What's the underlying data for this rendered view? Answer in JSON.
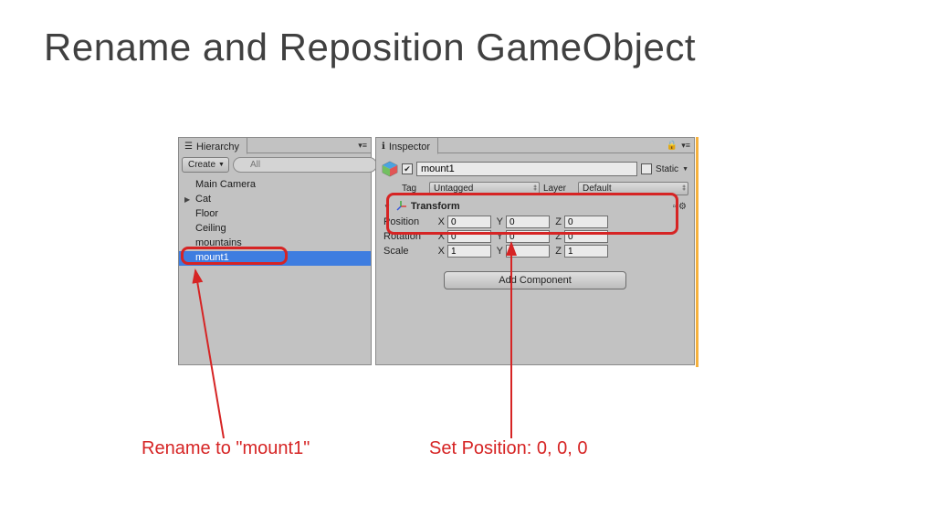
{
  "slide": {
    "title": "Rename and Reposition GameObject"
  },
  "hierarchy": {
    "tab_label": "Hierarchy",
    "create_label": "Create",
    "search_placeholder": "All",
    "items": [
      {
        "label": "Main Camera",
        "expandable": false
      },
      {
        "label": "Cat",
        "expandable": true
      },
      {
        "label": "Floor",
        "expandable": false
      },
      {
        "label": "Ceiling",
        "expandable": false
      },
      {
        "label": "mountains",
        "expandable": false
      },
      {
        "label": "mount1",
        "expandable": false,
        "selected": true
      }
    ]
  },
  "inspector": {
    "tab_label": "Inspector",
    "object_name": "mount1",
    "enabled": true,
    "static_label": "Static",
    "static_checked": false,
    "tag_label": "Tag",
    "tag_value": "Untagged",
    "layer_label": "Layer",
    "layer_value": "Default",
    "transform": {
      "header": "Transform",
      "position_label": "Position",
      "rotation_label": "Rotation",
      "scale_label": "Scale",
      "x_label": "X",
      "y_label": "Y",
      "z_label": "Z",
      "position": {
        "x": "0",
        "y": "0",
        "z": "0"
      },
      "rotation": {
        "x": "0",
        "y": "0",
        "z": "0"
      },
      "scale": {
        "x": "1",
        "y": "1",
        "z": "1"
      }
    },
    "add_component_label": "Add Component"
  },
  "annotations": {
    "rename": "Rename to \"mount1\"",
    "setpos": "Set Position: 0, 0, 0"
  }
}
